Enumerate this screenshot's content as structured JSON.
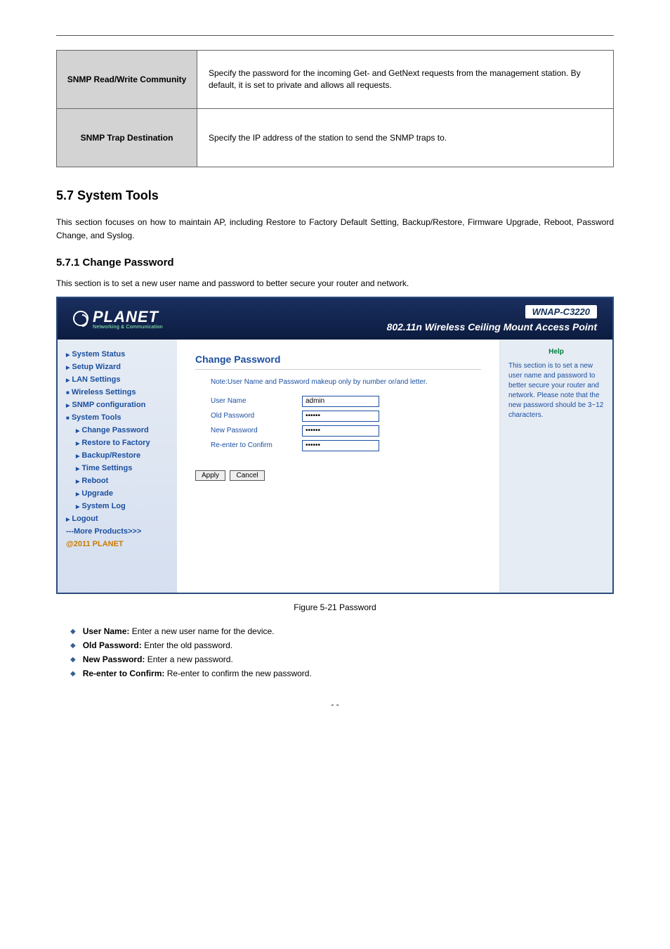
{
  "table": {
    "row1": {
      "k": "SNMP Read/Write Community",
      "v": "Specify the password for the incoming Get- and GetNext requests from the management station. By default, it is set to private and allows all requests."
    },
    "row2": {
      "k": "SNMP Trap Destination",
      "v": "Specify the IP address of the station to send the SNMP traps to."
    }
  },
  "section": {
    "num": "5.7",
    "title": "System Tools",
    "intro": "This section focuses on how to maintain AP, including Restore to Factory Default Setting, Backup/Restore, Firmware Upgrade, Reboot, Password Change, and Syslog.",
    "sub_num": "5.7.1",
    "sub_title": "Change Password",
    "sub_intro": "This section is to set a new user name and password to better secure your router and network.",
    "fig": "Figure 5-21 Password",
    "bullets": [
      {
        "label": "User Name",
        "val": "Enter a new user name for the device."
      },
      {
        "label": "Old Password",
        "val": "Enter the old password."
      },
      {
        "label": "New Password",
        "val": "Enter a new password."
      },
      {
        "label": "Re-enter to Confirm",
        "val": "Re-enter to confirm the new password."
      }
    ]
  },
  "screenshot": {
    "brand": "PLANET",
    "brand_sub": "Networking & Communication",
    "model": "WNAP-C3220",
    "head_title": "802.11n Wireless Ceiling Mount Access Point",
    "menu": [
      {
        "label": "System Status",
        "cls": "mi arrow"
      },
      {
        "label": "Setup Wizard",
        "cls": "mi arrow"
      },
      {
        "label": "LAN Settings",
        "cls": "mi arrow"
      },
      {
        "label": "Wireless Settings",
        "cls": "mi block"
      },
      {
        "label": "SNMP configuration",
        "cls": "mi arrow"
      },
      {
        "label": "System Tools",
        "cls": "mi block"
      },
      {
        "label": "Change Password",
        "cls": "mi sub arrow"
      },
      {
        "label": "Restore to Factory",
        "cls": "mi sub arrow"
      },
      {
        "label": "Backup/Restore",
        "cls": "mi sub arrow"
      },
      {
        "label": "Time Settings",
        "cls": "mi sub arrow"
      },
      {
        "label": "Reboot",
        "cls": "mi sub arrow"
      },
      {
        "label": "Upgrade",
        "cls": "mi sub arrow"
      },
      {
        "label": "System Log",
        "cls": "mi sub arrow"
      },
      {
        "label": "Logout",
        "cls": "mi arrow"
      },
      {
        "label": "---More Products>>>",
        "cls": "mi"
      },
      {
        "label": "@2011 PLANET",
        "cls": "mi orange"
      }
    ],
    "panel_title": "Change Password",
    "panel_note": "Note:User Name and Password makeup only by number or/and letter.",
    "fields": {
      "u_label": "User Name",
      "u_val": "admin",
      "o_label": "Old Password",
      "o_val": "••••••",
      "n_label": "New Password",
      "n_val": "••••••",
      "r_label": "Re-enter to Confirm",
      "r_val": "••••••"
    },
    "apply": "Apply",
    "cancel": "Cancel",
    "help_t": "Help",
    "help_b": "This section is to set a new user name and password to better secure your router and network. Please note that the new password should be 3~12 characters."
  },
  "pagenum": "-  -"
}
